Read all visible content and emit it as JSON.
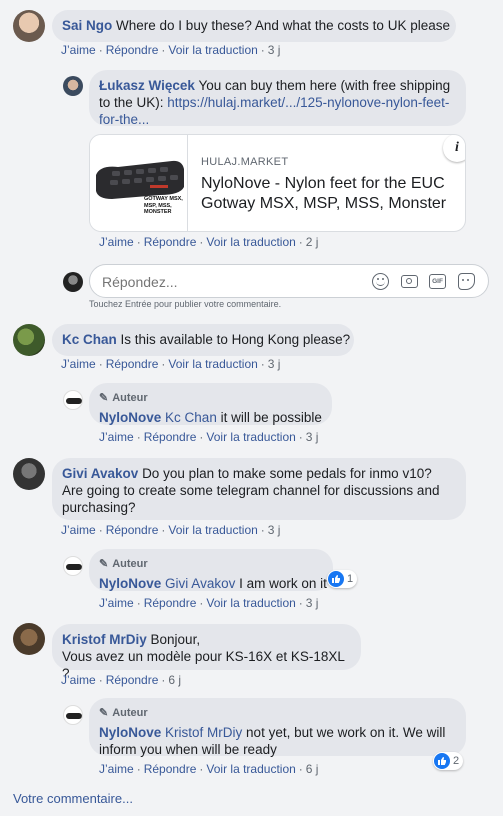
{
  "actions": {
    "like": "J’aime",
    "reply": "Répondre",
    "translate": "Voir la traduction"
  },
  "comments": [
    {
      "author": "Sai Ngo",
      "text": "Where do I buy these? And what the costs to UK please",
      "time": "3 j"
    },
    {
      "author": "Kc Chan",
      "text": "Is this available to Hong Kong please?",
      "time": "3 j"
    },
    {
      "author": "Givi Avakov",
      "text": "Do you plan to make some pedals for inmo v10? Are going to create some telegram channel for discussions and purchasing?",
      "time": "3 j"
    },
    {
      "author": "Kristof MrDiy",
      "text_line1": "Bonjour,",
      "text_line2": "Vous avez un modèle pour KS-16X et KS-18XL ?",
      "time": "6 j"
    }
  ],
  "replies": [
    {
      "author": "Łukasz Więcek",
      "text": "You can buy them here (with free shipping to the UK): ",
      "link": "https://hulaj.market/.../125-nylonove-nylon-feet-for-the...",
      "time": "2 j"
    },
    {
      "badge": "Auteur",
      "author": "NyloNove",
      "mention": "Kc Chan",
      "text": " it will be possible",
      "time": "3 j"
    },
    {
      "badge": "Auteur",
      "author": "NyloNove",
      "mention": "Givi Avakov",
      "text": " I am work on it",
      "time": "3 j",
      "likes": "1"
    },
    {
      "badge": "Auteur",
      "author": "NyloNove",
      "mention": "Kristof MrDiy",
      "text": " not yet, but we work on it. We will inform you when will be ready",
      "time": "6 j",
      "likes": "2"
    }
  ],
  "link_preview": {
    "domain": "HULAJ.MARKET",
    "title": "NyloNove - Nylon feet for the EUC Gotway MSX, MSP, MSS, Monster",
    "thumb_caption": "GOTWAY MSX, MSP, MSS, MONSTER",
    "info_icon": "i"
  },
  "composer": {
    "placeholder": "Répondez...",
    "hint": "Touchez Entrée pour publier votre commentaire.",
    "gif_label": "GIF"
  },
  "footer": {
    "write_comment": "Votre commentaire..."
  },
  "colors": {
    "link": "#385898",
    "bubble": "#e4e6eb",
    "background": "#f2f3f5",
    "like": "#1877f2"
  }
}
